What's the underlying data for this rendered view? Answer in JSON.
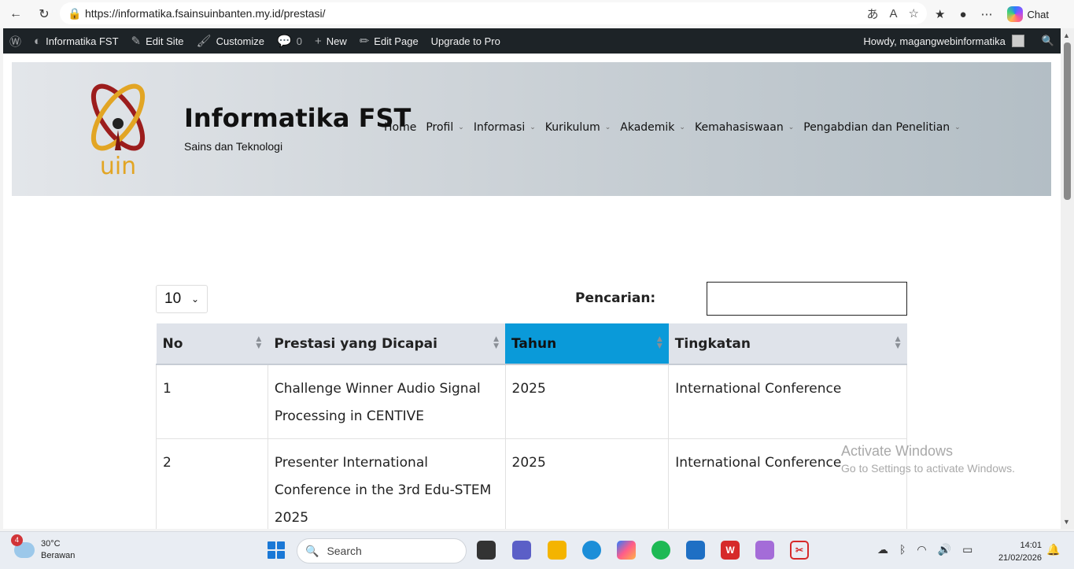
{
  "browser": {
    "url": "https://informatika.fsainsuinbanten.my.id/prestasi/",
    "chat_label": "Chat"
  },
  "wpbar": {
    "site_name": "Informatika FST",
    "edit_site": "Edit Site",
    "customize": "Customize",
    "comments_count": "0",
    "new_label": "New",
    "edit_page": "Edit Page",
    "upgrade": "Upgrade to Pro",
    "howdy": "Howdy, magangwebinformatika"
  },
  "header": {
    "title": "Informatika FST",
    "tagline": "Sains dan Teknologi",
    "menu": [
      {
        "label": "Home"
      },
      {
        "label": "Profil"
      },
      {
        "label": "Informasi"
      },
      {
        "label": "Kurikulum"
      },
      {
        "label": "Akademik"
      },
      {
        "label": "Kemahasiswaan"
      },
      {
        "label": "Pengabdian dan Penelitian"
      }
    ]
  },
  "table_controls": {
    "length_value": "10",
    "search_label": "Pencarian:"
  },
  "table": {
    "headers": [
      "No",
      "Prestasi yang Dicapai",
      "Tahun",
      "Tingkatan"
    ],
    "rows": [
      [
        "1",
        "Challenge Winner Audio Signal Processing in CENTIVE",
        "2025",
        "International Conference"
      ],
      [
        "2",
        "Presenter International Conference in the 3rd Edu-STEM 2025",
        "2025",
        "International Conference"
      ]
    ]
  },
  "watermark": {
    "title": "Activate Windows",
    "subtitle": "Go to Settings to activate Windows."
  },
  "taskbar": {
    "weather_badge": "4",
    "temperature": "30°C",
    "condition": "Berawan",
    "search_label": "Search",
    "time": "14:01",
    "date": "21/02/2026"
  }
}
